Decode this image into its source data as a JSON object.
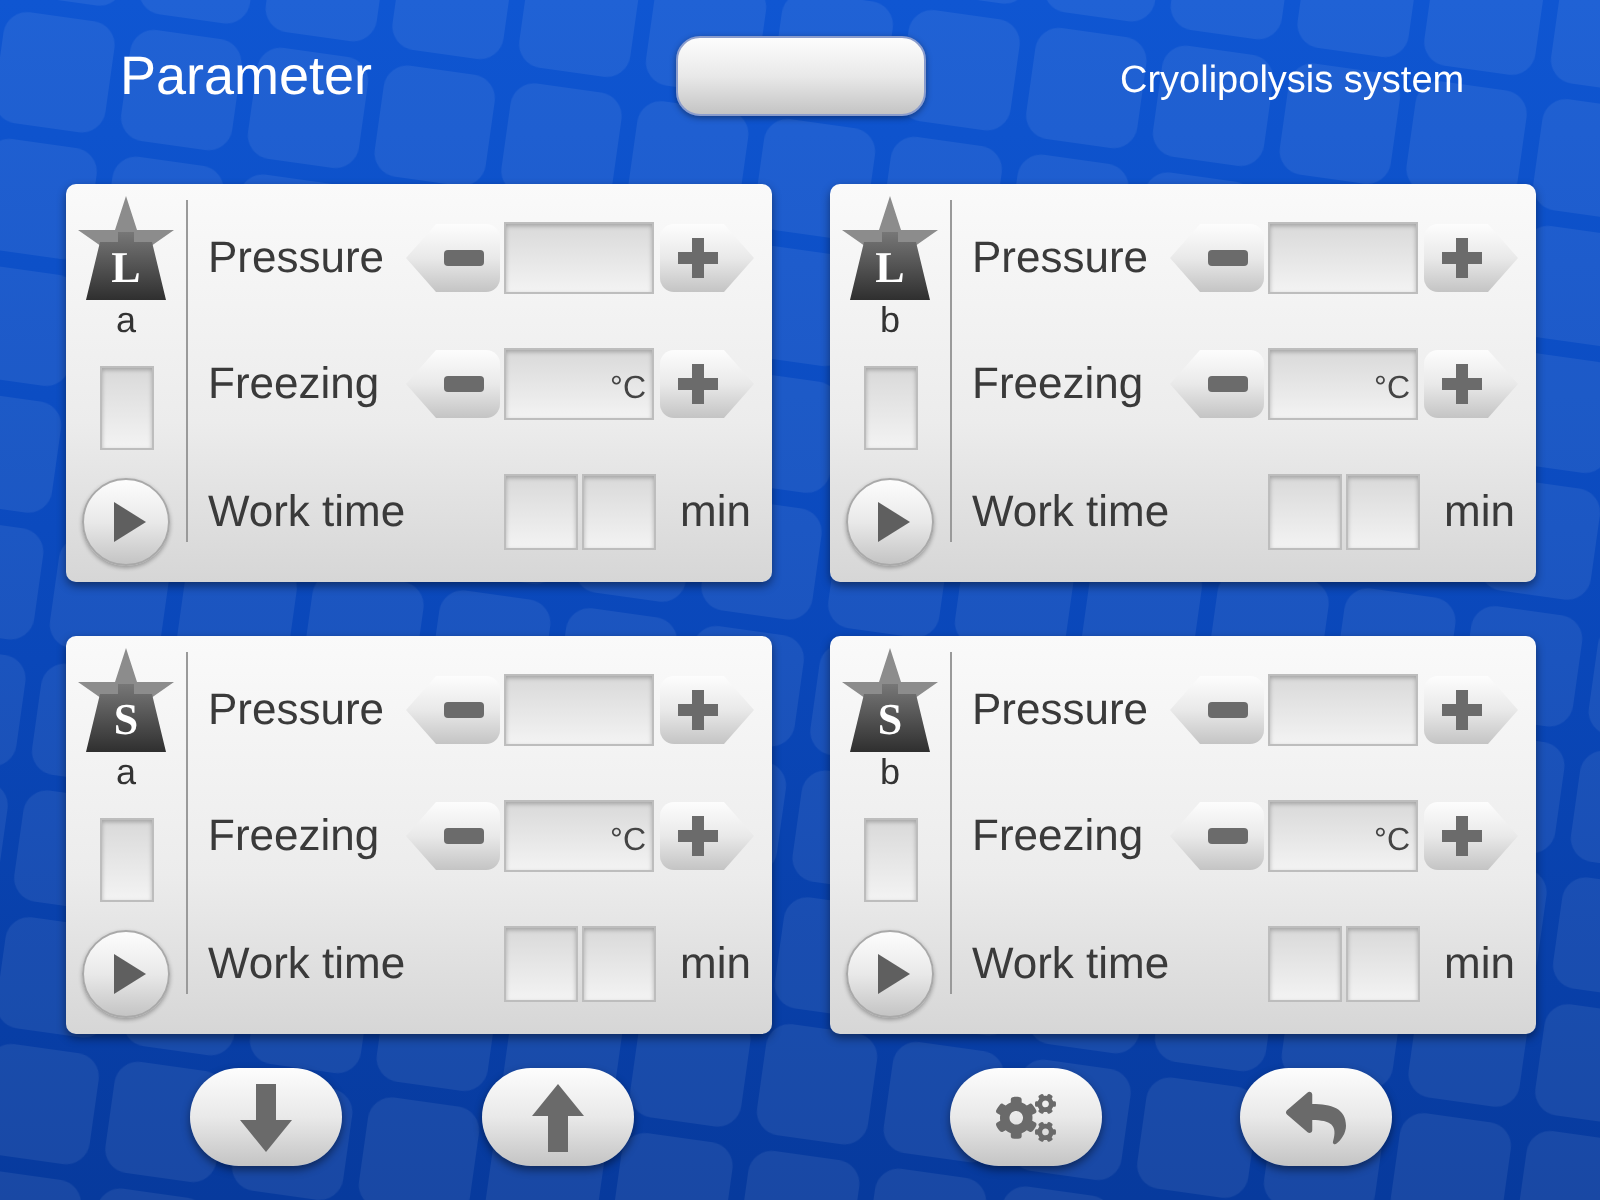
{
  "header": {
    "title": "Parameter",
    "subtitle": "Cryolipolysis system"
  },
  "panels": [
    {
      "mode": "L",
      "channel": "a",
      "rows": [
        {
          "kind": "stepper",
          "label": "Pressure"
        },
        {
          "kind": "stepper",
          "label": "Freezing",
          "unit": "°C"
        },
        {
          "kind": "time",
          "label": "Work time",
          "unit": "min"
        }
      ]
    },
    {
      "mode": "L",
      "channel": "b",
      "rows": [
        {
          "kind": "stepper",
          "label": "Pressure"
        },
        {
          "kind": "stepper",
          "label": "Freezing",
          "unit": "°C"
        },
        {
          "kind": "time",
          "label": "Work time",
          "unit": "min"
        }
      ]
    },
    {
      "mode": "S",
      "channel": "a",
      "rows": [
        {
          "kind": "stepper",
          "label": "Pressure"
        },
        {
          "kind": "stepper",
          "label": "Freezing",
          "unit": "°C"
        },
        {
          "kind": "time",
          "label": "Work time",
          "unit": "min"
        }
      ]
    },
    {
      "mode": "S",
      "channel": "b",
      "rows": [
        {
          "kind": "stepper",
          "label": "Pressure"
        },
        {
          "kind": "stepper",
          "label": "Freezing",
          "unit": "°C"
        },
        {
          "kind": "time",
          "label": "Work time",
          "unit": "min"
        }
      ]
    }
  ],
  "toolbar": [
    {
      "kind": "down"
    },
    {
      "kind": "up"
    },
    {
      "kind": "settings"
    },
    {
      "kind": "back"
    }
  ]
}
